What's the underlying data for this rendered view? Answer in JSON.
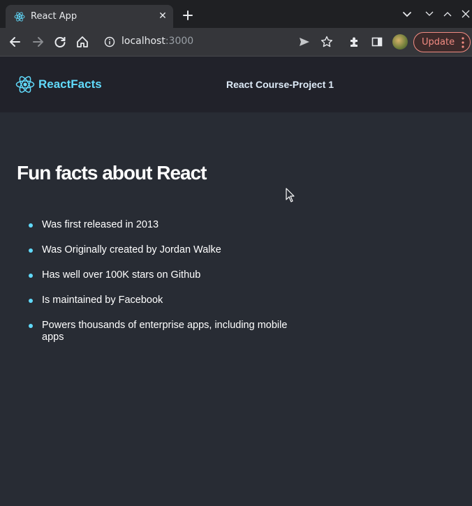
{
  "browser": {
    "tab_title": "React App",
    "tab_close": "✕",
    "url_host": "localhost",
    "url_port": ":3000",
    "update_label": "Update"
  },
  "navbar": {
    "brand": "ReactFacts",
    "title": "React Course-Project 1"
  },
  "main": {
    "title": "Fun facts about React",
    "facts": [
      "Was first released in 2013",
      "Was Originally created by Jordan Walke",
      "Has well over 100K stars on Github",
      "Is maintained by Facebook",
      "Powers thousands of enterprise apps, including mobile apps"
    ]
  },
  "colors": {
    "accent": "#61dafb",
    "page_bg": "#282c34",
    "nav_bg": "#21222a",
    "update": "#f28b82"
  },
  "icons": [
    "react-icon",
    "close-icon",
    "plus-icon",
    "chevron-down-icon",
    "minimize-icon",
    "maximize-icon",
    "back-icon",
    "forward-icon",
    "reload-icon",
    "home-icon",
    "info-icon",
    "send-icon",
    "star-icon",
    "extensions-icon",
    "side-panel-icon",
    "menu-icon",
    "cursor-icon"
  ]
}
